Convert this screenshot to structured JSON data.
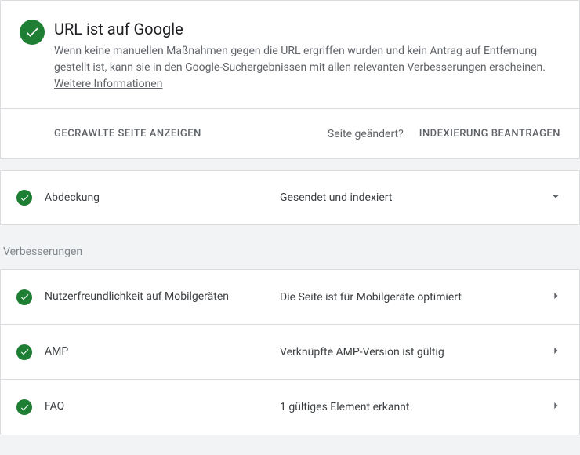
{
  "status": {
    "title": "URL ist auf Google",
    "description_prefix": "Wenn keine manuellen Maßnahmen gegen die URL ergriffen wurden und kein Antrag auf Entfernung gestellt ist, kann sie in den Google-Suchergebnissen mit allen relevanten Verbesserungen erscheinen. ",
    "more_info": "Weitere Informationen",
    "icon": "check-circle",
    "icon_color": "#1e7e34"
  },
  "actions": {
    "view_crawled": "GECRAWLTE SEITE ANZEIGEN",
    "page_changed": "Seite geändert?",
    "request_indexing": "INDEXIERUNG BEANTRAGEN"
  },
  "coverage": {
    "label": "Abdeckung",
    "value": "Gesendet und indexiert"
  },
  "enhancements": {
    "title": "Verbesserungen",
    "rows": [
      {
        "label": "Nutzerfreundlichkeit auf Mobilgeräten",
        "value": "Die Seite ist für Mobilgeräte optimiert"
      },
      {
        "label": "AMP",
        "value": "Verknüpfte AMP-Version ist gültig"
      },
      {
        "label": "FAQ",
        "value": "1 gültiges Element erkannt"
      }
    ]
  }
}
